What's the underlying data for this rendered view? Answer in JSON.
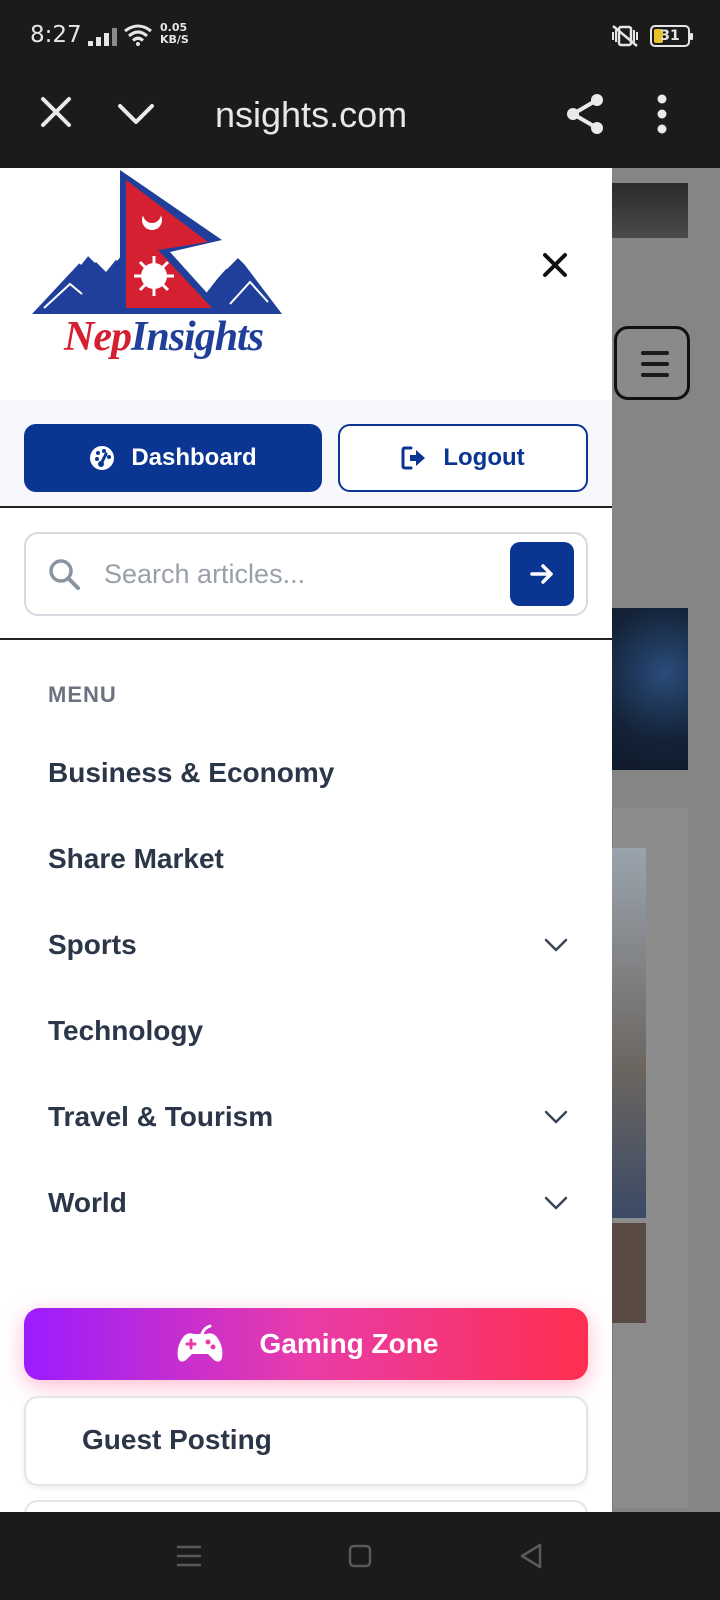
{
  "status_bar": {
    "time": "8:27",
    "net_speed_value": "0.05",
    "net_speed_unit": "KB/S",
    "battery": "31",
    "battery_color": "#e6c22c"
  },
  "browser": {
    "url": "insights.com",
    "icons": [
      "close-icon",
      "chevron-down-icon",
      "share-icon",
      "more-vert-icon"
    ]
  },
  "drawer": {
    "logo": {
      "word1": "Nep",
      "word2": "Insights"
    },
    "account": {
      "dashboard_label": "Dashboard",
      "logout_label": "Logout"
    },
    "search": {
      "placeholder": "Search articles..."
    },
    "menu": {
      "heading": "MENU",
      "items": [
        {
          "label": "Business & Economy",
          "has_submenu": false
        },
        {
          "label": "Share Market",
          "has_submenu": false
        },
        {
          "label": "Sports",
          "has_submenu": true
        },
        {
          "label": "Technology",
          "has_submenu": false
        },
        {
          "label": "Travel & Tourism",
          "has_submenu": true
        },
        {
          "label": "World",
          "has_submenu": true
        }
      ]
    },
    "gaming_zone_label": "Gaming Zone",
    "guest_posting_label": "Guest Posting"
  },
  "colors": {
    "brand_blue": "#0b3592",
    "text_dark": "#2b3648",
    "gradient_start": "#9b1cff",
    "gradient_end": "#ff2f4f"
  }
}
